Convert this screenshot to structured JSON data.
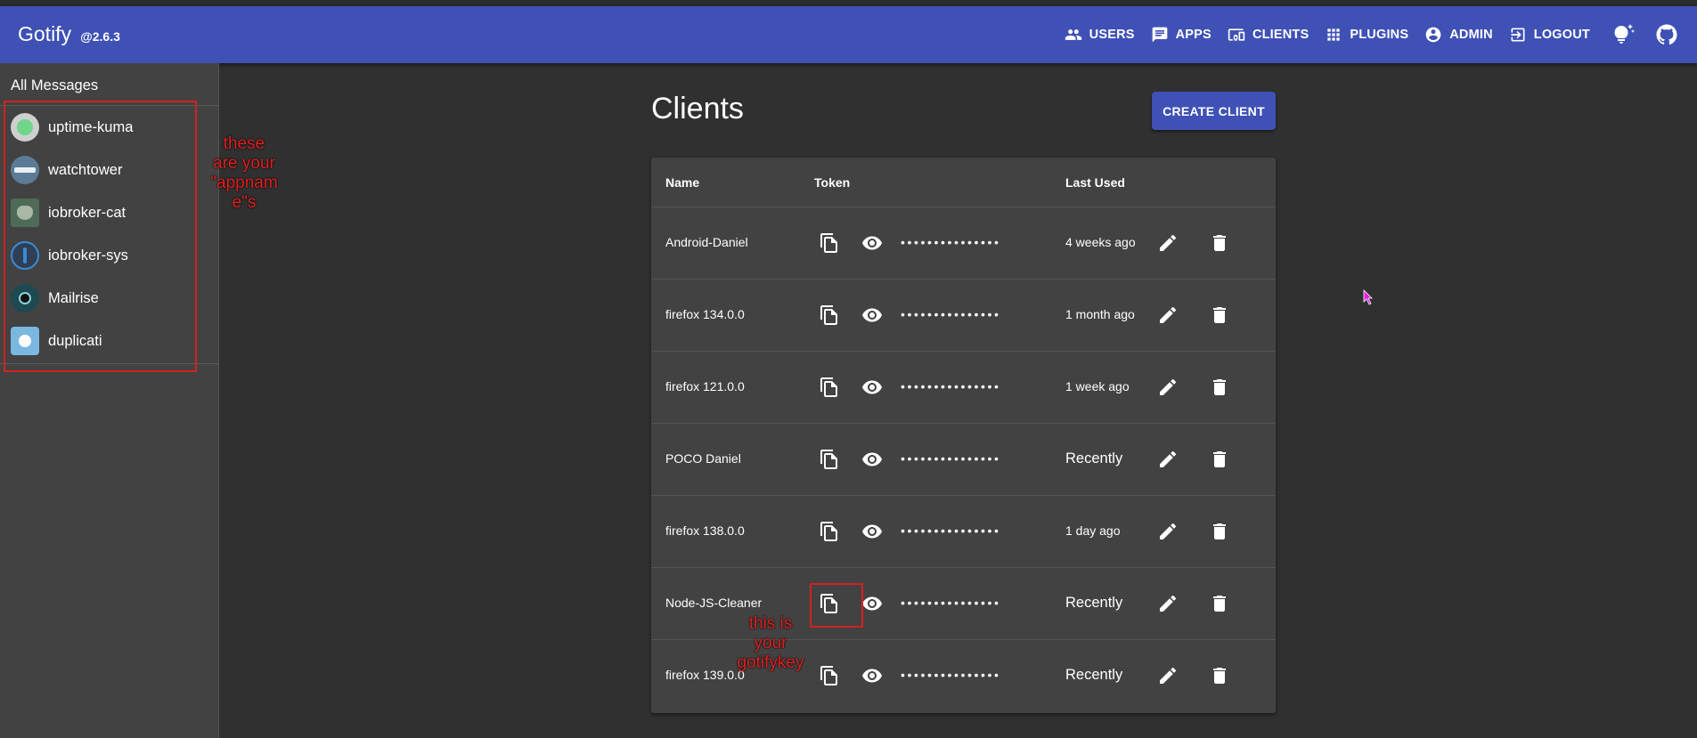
{
  "header": {
    "title": "Gotify",
    "version": "@2.6.3",
    "nav": [
      {
        "label": "USERS",
        "icon": "users-icon"
      },
      {
        "label": "APPS",
        "icon": "chat-icon"
      },
      {
        "label": "CLIENTS",
        "icon": "devices-icon"
      },
      {
        "label": "PLUGINS",
        "icon": "apps-grid-icon"
      },
      {
        "label": "ADMIN",
        "icon": "account-circle-icon"
      },
      {
        "label": "LOGOUT",
        "icon": "exit-icon"
      }
    ],
    "theme_icon": "lightbulb-icon",
    "github_icon": "github-icon"
  },
  "sidebar": {
    "all_messages": "All Messages",
    "apps": [
      {
        "name": "uptime-kuma",
        "icon": "uptime-kuma-logo"
      },
      {
        "name": "watchtower",
        "icon": "watchtower-logo"
      },
      {
        "name": "iobroker-cat",
        "icon": "iobroker-cat-logo"
      },
      {
        "name": "iobroker-sys",
        "icon": "iobroker-logo"
      },
      {
        "name": "Mailrise",
        "icon": "mailrise-logo"
      },
      {
        "name": "duplicati",
        "icon": "duplicati-logo"
      }
    ]
  },
  "main": {
    "title": "Clients",
    "create_button": "CREATE CLIENT",
    "columns": {
      "name": "Name",
      "token": "Token",
      "last_used": "Last Used"
    },
    "token_mask": "•••••••••••••••",
    "clients": [
      {
        "name": "Android-Daniel",
        "last_used": "4 weeks ago"
      },
      {
        "name": "firefox 134.0.0",
        "last_used": "1 month ago"
      },
      {
        "name": "firefox 121.0.0",
        "last_used": "1 week ago"
      },
      {
        "name": "POCO Daniel",
        "last_used": "Recently"
      },
      {
        "name": "firefox 138.0.0",
        "last_used": "1 day ago"
      },
      {
        "name": "Node-JS-Cleaner",
        "last_used": "Recently"
      },
      {
        "name": "firefox 139.0.0",
        "last_used": "Recently"
      }
    ]
  },
  "annotations": {
    "appname_note": "these are your \"appname\"s",
    "appname_note_lines": [
      "these",
      "are your",
      "\"appnam",
      "e\"s"
    ],
    "key_note": "this is your gotifykey",
    "key_note_lines": [
      "this is",
      "your",
      "gotifykey"
    ]
  },
  "colors": {
    "appbar": "#3f51b5",
    "background": "#303030",
    "panel": "#424242",
    "annotation": "#d32020"
  }
}
